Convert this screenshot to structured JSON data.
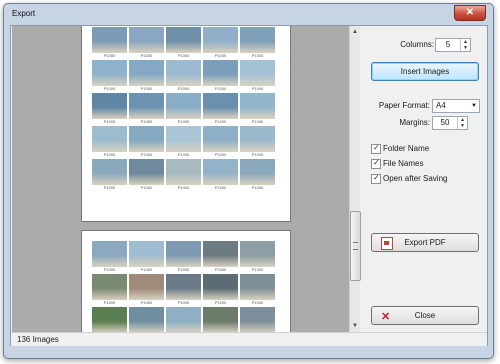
{
  "window": {
    "title": "Export",
    "close_glyph": "✕"
  },
  "controls": {
    "columns_label": "Columns:",
    "columns_value": "5",
    "insert_images_label": "Insert Images",
    "paper_format_label": "Paper Format:",
    "paper_format_value": "A4",
    "margins_label": "Margins:",
    "margins_value": "50",
    "checkboxes": [
      {
        "label": "Folder Name",
        "checked": true
      },
      {
        "label": "File Names",
        "checked": true
      },
      {
        "label": "Open after Saving",
        "checked": true
      }
    ],
    "export_pdf_label": "Export PDF",
    "close_label": "Close"
  },
  "icons": {
    "export_pdf": "pdf-icon",
    "close": "close-x-icon",
    "spin": "spinner-arrows-icon"
  },
  "status": {
    "text": "136 Images"
  },
  "preview": {
    "caption": "P1000",
    "page1_rows": [
      [
        "#7e9bb5",
        "#8aa6c0",
        "#6f8fa9",
        "#91b0c8",
        "#7fa0b8"
      ],
      [
        "#8fb2cc",
        "#85a8c4",
        "#9cbbd2",
        "#7b9fbb",
        "#a4c2d6"
      ],
      [
        "#5f86a5",
        "#6d93b0",
        "#8aaec8",
        "#6b8fae",
        "#94b6cc"
      ],
      [
        "#9dbccf",
        "#86a9c2",
        "#a9c5d6",
        "#8db0c8",
        "#9bb9cc"
      ],
      [
        "#8ba9bd",
        "#6e8a9c",
        "#a8b9c2",
        "#93b3c8",
        "#8aa8bc"
      ]
    ],
    "page2_rows": [
      [
        "#8aa8bf",
        "#9fbcd0",
        "#7d9ab2",
        "#6c7a82",
        "#8d9ea6"
      ],
      [
        "#7a8a72",
        "#a08a7a",
        "#6a7a88",
        "#5c6c74",
        "#7f8f98"
      ],
      [
        "#5b7f52",
        "#6f8fa0",
        "#8fb0c4",
        "#6b7c6a",
        "#7d8f9a"
      ]
    ]
  }
}
